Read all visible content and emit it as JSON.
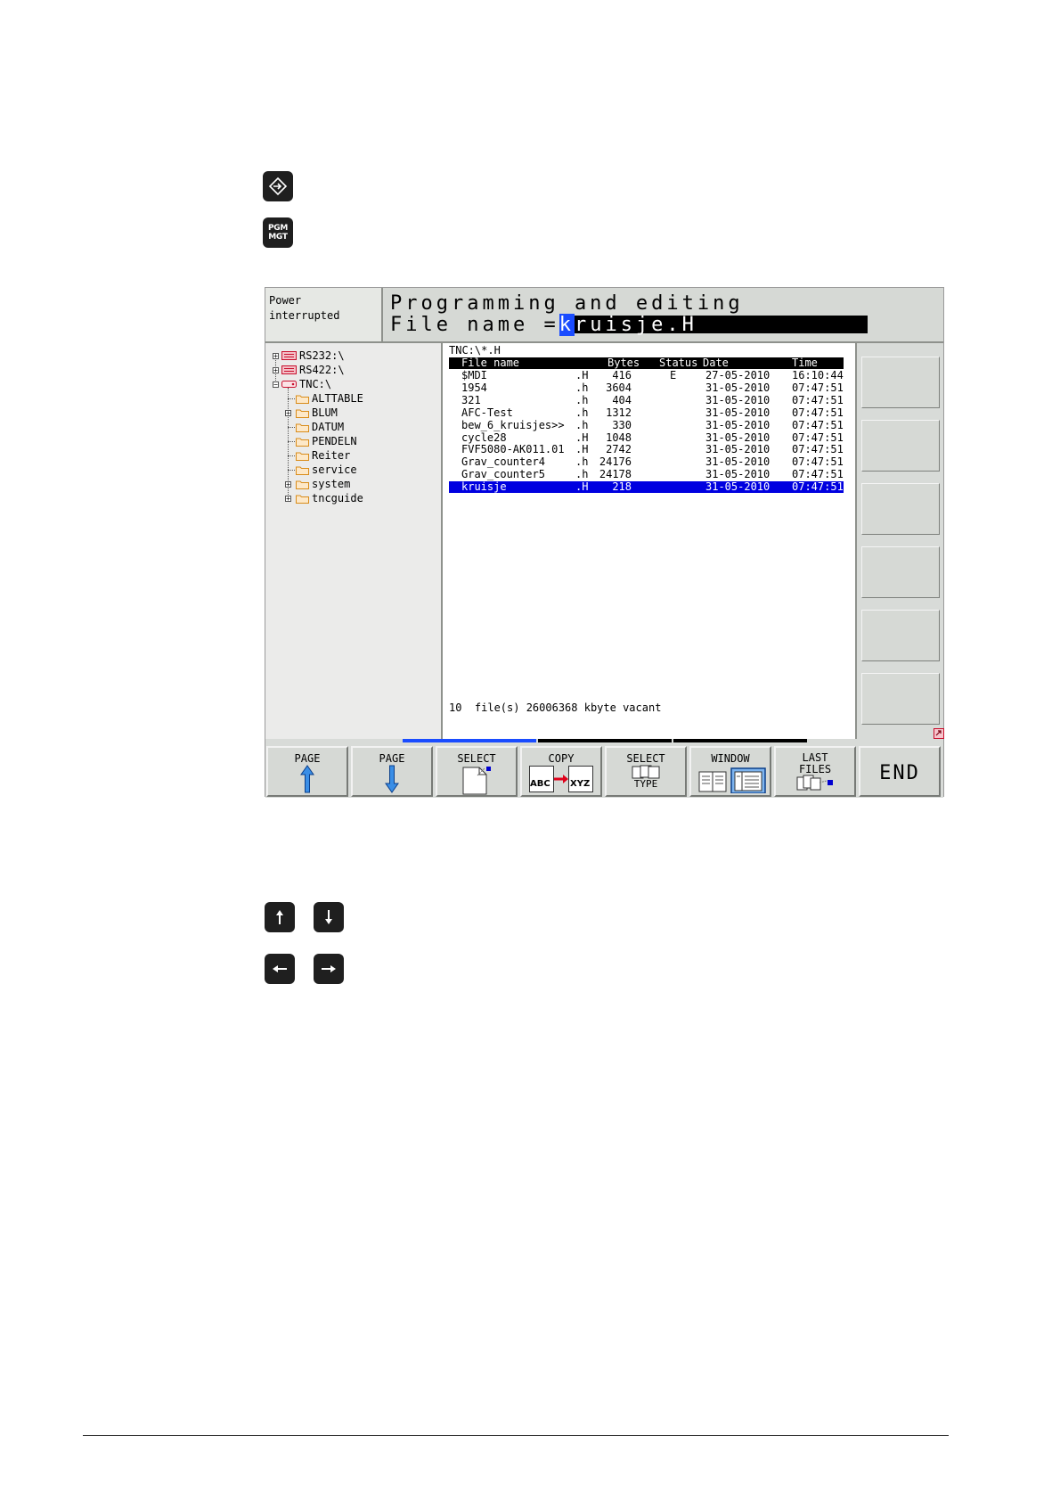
{
  "side_keys": {
    "pgm_mgt_line1": "PGM",
    "pgm_mgt_line2": "MGT"
  },
  "screen": {
    "status": {
      "line1": "Power",
      "line2": "interrupted"
    },
    "mode_title": "Programming and editing",
    "file_name_label": "File name =",
    "file_name_cursor_char": "k",
    "file_name_rest": "ruisje.H",
    "tree": [
      {
        "label": "RS232:\\",
        "type": "drive"
      },
      {
        "label": "RS422:\\",
        "type": "drive"
      },
      {
        "label": "TNC:\\",
        "type": "drive"
      },
      {
        "label": "ALTTABLE",
        "type": "folder"
      },
      {
        "label": "BLUM",
        "type": "folder"
      },
      {
        "label": "DATUM",
        "type": "folder"
      },
      {
        "label": "PENDELN",
        "type": "folder"
      },
      {
        "label": "Reiter",
        "type": "folder"
      },
      {
        "label": "service",
        "type": "folder"
      },
      {
        "label": "system",
        "type": "folder"
      },
      {
        "label": "tncguide",
        "type": "folder"
      }
    ],
    "current_path": "TNC:\\*.H",
    "columns": {
      "name": "File name",
      "bytes": "Bytes",
      "status": "Status",
      "date": "Date",
      "time": "Time"
    },
    "files": [
      {
        "name": "$MDI",
        "ext": ".H",
        "bytes": "416",
        "status": "E",
        "date": "27-05-2010",
        "time": "16:10:44"
      },
      {
        "name": "1954",
        "ext": ".h",
        "bytes": "3604",
        "status": "",
        "date": "31-05-2010",
        "time": "07:47:51"
      },
      {
        "name": "321",
        "ext": ".h",
        "bytes": "404",
        "status": "",
        "date": "31-05-2010",
        "time": "07:47:51"
      },
      {
        "name": "AFC-Test",
        "ext": ".h",
        "bytes": "1312",
        "status": "",
        "date": "31-05-2010",
        "time": "07:47:51"
      },
      {
        "name": "bew_6_kruisjes>>",
        "ext": ".h",
        "bytes": "330",
        "status": "",
        "date": "31-05-2010",
        "time": "07:47:51"
      },
      {
        "name": "cycle28",
        "ext": ".H",
        "bytes": "1048",
        "status": "",
        "date": "31-05-2010",
        "time": "07:47:51"
      },
      {
        "name": "FVF5080-AK011.01",
        "ext": ".H",
        "bytes": "2742",
        "status": "",
        "date": "31-05-2010",
        "time": "07:47:51"
      },
      {
        "name": "Grav_counter4",
        "ext": ".h",
        "bytes": "24176",
        "status": "",
        "date": "31-05-2010",
        "time": "07:47:51"
      },
      {
        "name": "Grav_counter5",
        "ext": ".h",
        "bytes": "24178",
        "status": "",
        "date": "31-05-2010",
        "time": "07:47:51"
      },
      {
        "name": "kruisje",
        "ext": ".H",
        "bytes": "218",
        "status": "",
        "date": "31-05-2010",
        "time": "07:47:51"
      }
    ],
    "selected_file_index": 9,
    "summary": "10  file(s) 26006368 kbyte vacant",
    "softkeys": [
      {
        "label": "PAGE",
        "icon": "arrow-up-icon"
      },
      {
        "label": "PAGE",
        "icon": "arrow-down-icon"
      },
      {
        "label": "SELECT",
        "icon": "file-select-icon"
      },
      {
        "label": "COPY",
        "icon": "copy-abc-xyz-icon",
        "sub1": "ABC",
        "sub2": "XYZ"
      },
      {
        "label": "SELECT",
        "icon": "file-type-icon",
        "sub": "TYPE"
      },
      {
        "label": "WINDOW",
        "icon": "window-layout-icon"
      },
      {
        "label": "LAST",
        "label2": "FILES",
        "icon": "last-files-icon"
      },
      {
        "label": "END"
      }
    ],
    "colors": {
      "selection": "#0000e0",
      "cursor": "#1a4cff",
      "panel": "#d8dbd8"
    }
  }
}
